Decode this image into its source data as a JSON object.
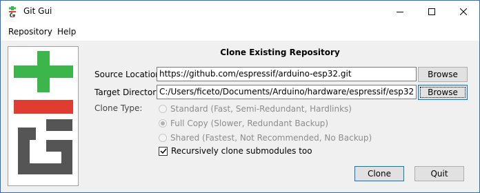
{
  "window": {
    "title": "Git Gui"
  },
  "menu": {
    "items": [
      "Repository",
      "Help"
    ]
  },
  "dialog": {
    "heading": "Clone Existing Repository",
    "source_label": "Source Location:",
    "source_value": "https://github.com/espressif/arduino-esp32.git",
    "target_label": "Target Directory:",
    "target_value": "C:/Users/ficeto/Documents/Arduino/hardware/espressif/esp32",
    "browse_label": "Browse",
    "clone_type_label": "Clone Type:",
    "clone_types": [
      {
        "label": "Standard (Fast, Semi-Redundant, Hardlinks)",
        "selected": false
      },
      {
        "label": "Full Copy (Slower, Redundant Backup)",
        "selected": true
      },
      {
        "label": "Shared (Fastest, Not Recommended, No Backup)",
        "selected": false
      }
    ],
    "recursive_label": "Recursively clone submodules too",
    "recursive_checked": true,
    "clone_button": "Clone",
    "quit_button": "Quit"
  },
  "colors": {
    "git_green": "#3cb54a",
    "git_red": "#e03c31",
    "git_gray": "#555555"
  }
}
